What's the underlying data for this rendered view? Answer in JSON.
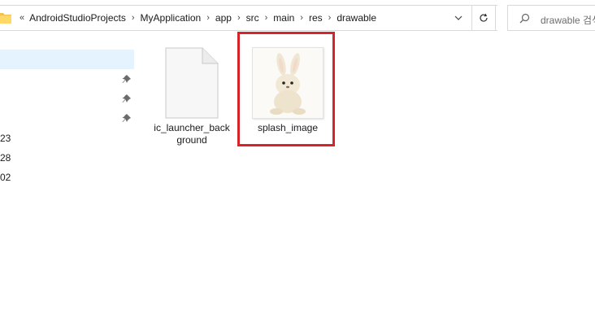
{
  "address_bar": {
    "overflow": "«",
    "crumbs": [
      "AndroidStudioProjects",
      "MyApplication",
      "app",
      "src",
      "main",
      "res",
      "drawable"
    ]
  },
  "search": {
    "placeholder": "drawable 검색"
  },
  "nav": {
    "rows": [
      {
        "label": "",
        "pinned": false,
        "selected": true
      },
      {
        "label": "",
        "pinned": true
      },
      {
        "label": "",
        "pinned": true
      },
      {
        "label": "",
        "pinned": true
      },
      {
        "label": "23"
      },
      {
        "label": "28"
      },
      {
        "label": "02"
      }
    ]
  },
  "files": [
    {
      "name": "ic_launcher_background",
      "type": "generic-file-icon"
    },
    {
      "name": "splash_image",
      "type": "image-thumbnail",
      "highlighted": true,
      "highlight_color": "#d6242b"
    }
  ],
  "colors": {
    "selection": "#e5f3ff",
    "highlight": "#d6242b"
  }
}
